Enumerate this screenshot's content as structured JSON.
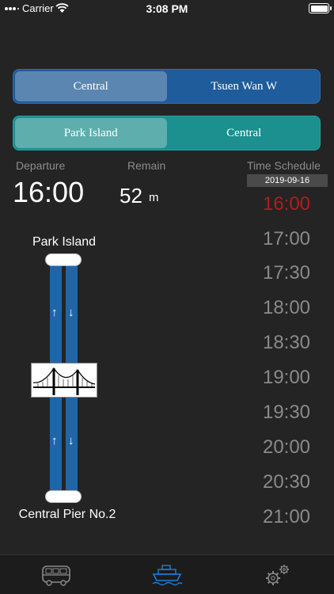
{
  "status_bar": {
    "carrier": "Carrier",
    "time": "3:08 PM"
  },
  "route_selector": {
    "options": [
      "Central",
      "Tsuen Wan W"
    ],
    "selected": 0
  },
  "direction_selector": {
    "options": [
      "Park Island",
      "Central"
    ],
    "selected": 0
  },
  "departure": {
    "label": "Departure",
    "value": "16:00"
  },
  "remain": {
    "label": "Remain",
    "value": "52",
    "unit": "m"
  },
  "schedule": {
    "label": "Time Schedule",
    "date": "2019-09-16",
    "times": [
      "16:00",
      "17:00",
      "17:30",
      "18:00",
      "18:30",
      "19:00",
      "19:30",
      "20:00",
      "20:30",
      "21:00"
    ],
    "current_index": 0
  },
  "route_diagram": {
    "top_station": "Park Island",
    "bottom_station": "Central Pier No.2",
    "bridge_icon": "bridge-icon"
  },
  "tabs": [
    {
      "name": "bus",
      "icon": "bus-icon",
      "active": false
    },
    {
      "name": "ferry",
      "icon": "ferry-icon",
      "active": true
    },
    {
      "name": "settings",
      "icon": "gear-icon",
      "active": false
    }
  ],
  "colors": {
    "accent": "#1a7fe0",
    "current_time": "#b41c1c",
    "route_seg": "#1f5c9c",
    "dir_seg": "#1c8f8f"
  }
}
